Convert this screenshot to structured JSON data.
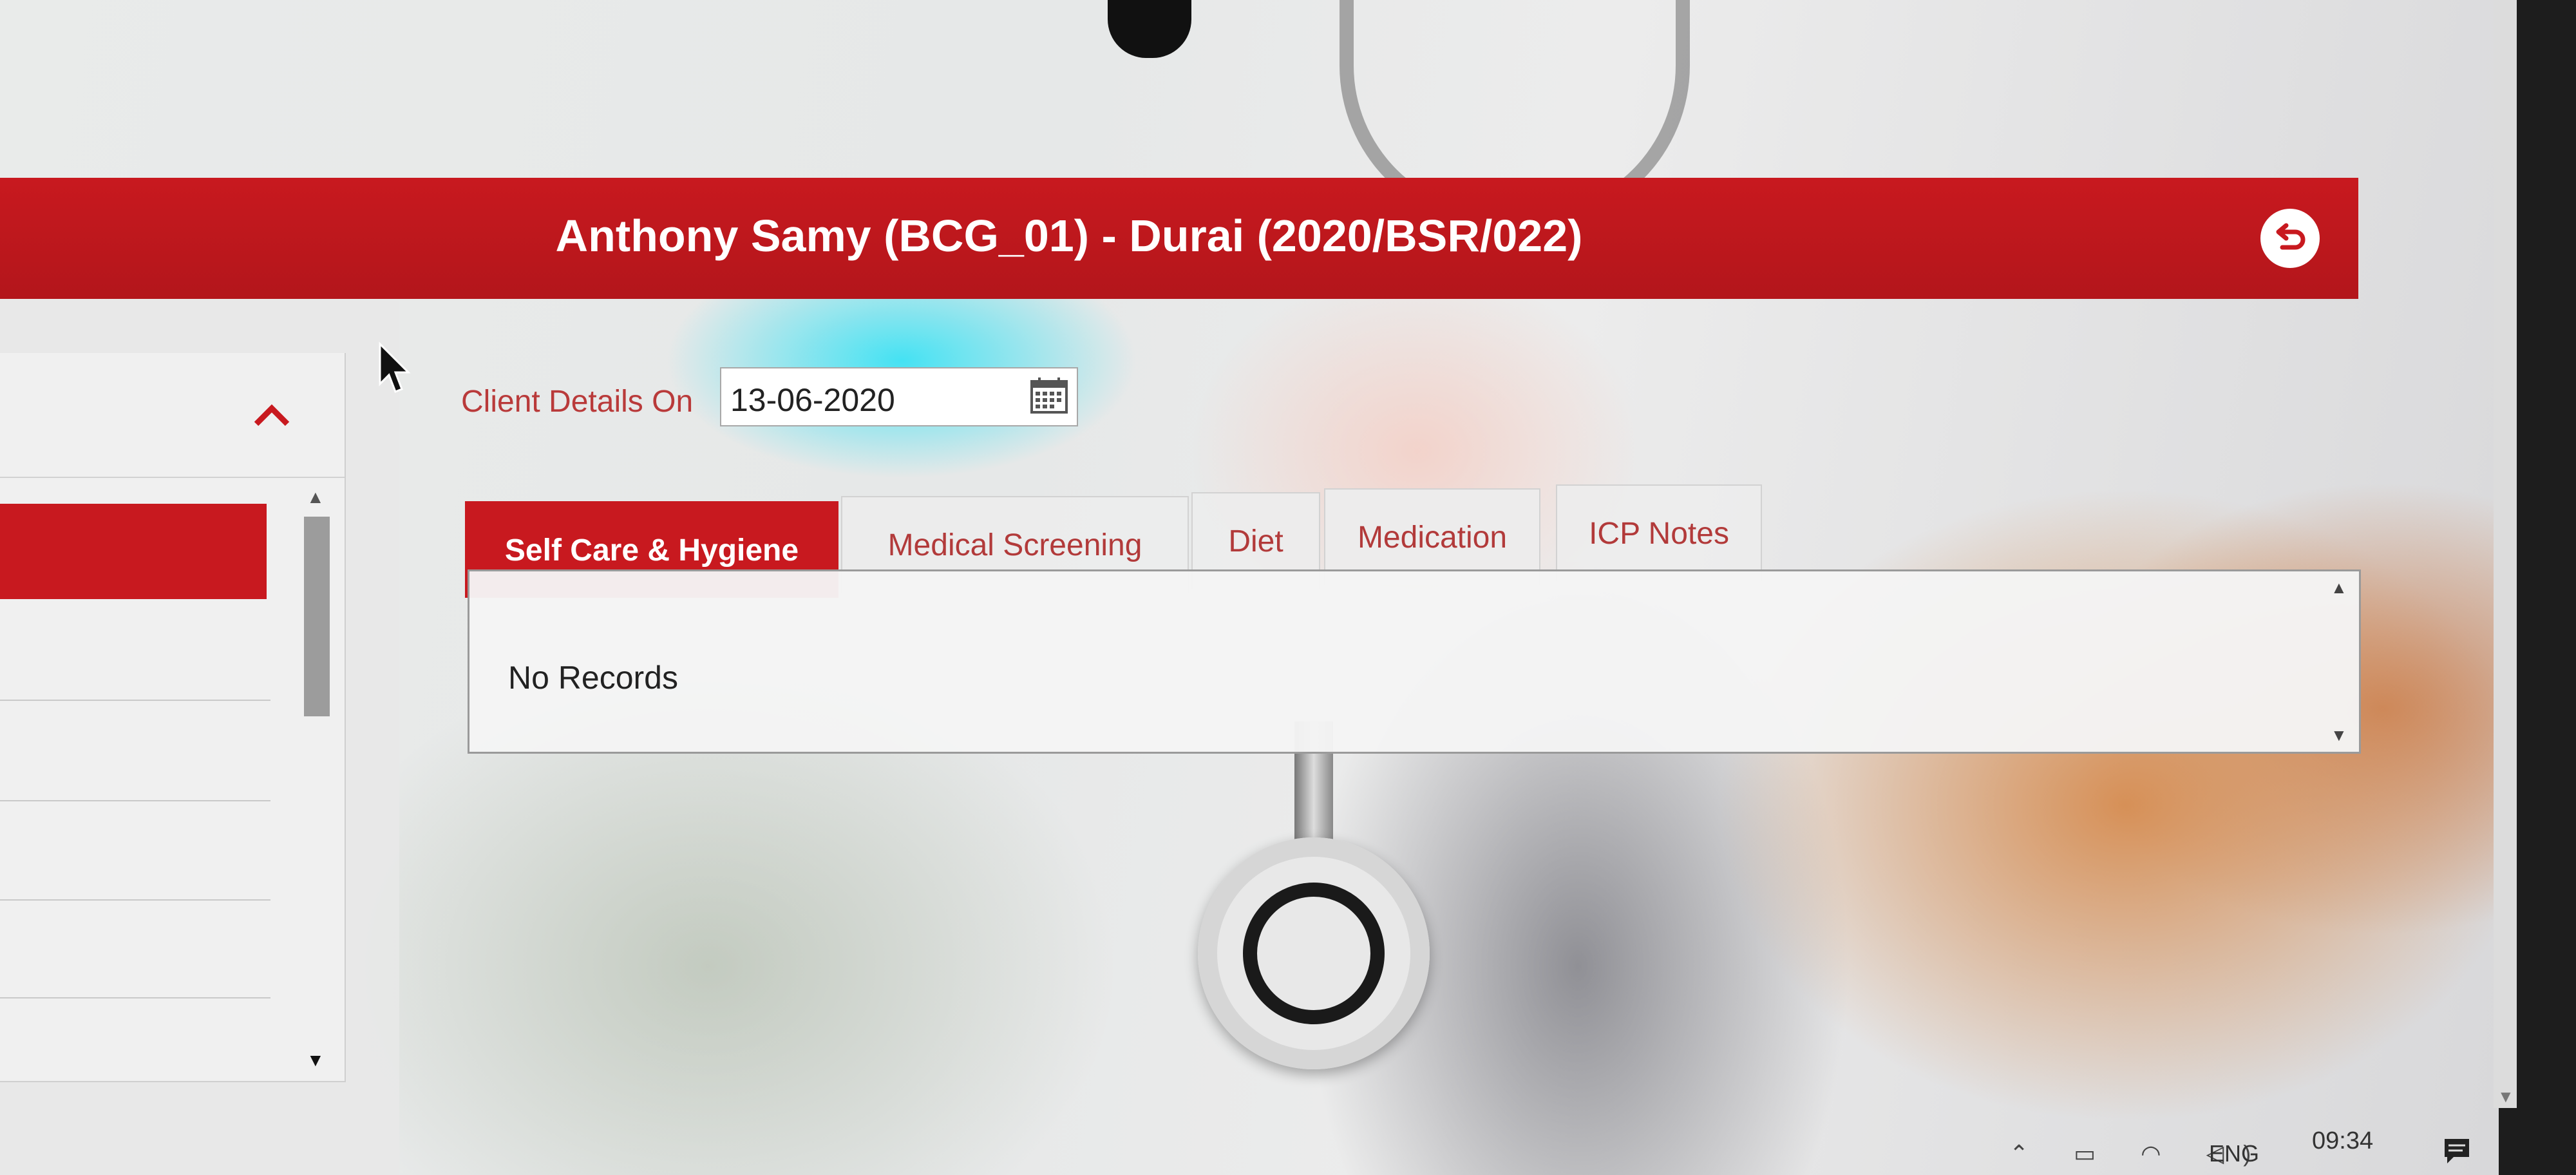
{
  "header": {
    "title": "Anthony Samy (BCG_01) - Durai (2020/BSR/022)",
    "back_icon": "back-arrow-icon"
  },
  "filter": {
    "label": "Client Details On",
    "date_value": "13-06-2020",
    "calendar_icon": "calendar-icon"
  },
  "tabs": [
    {
      "label": "Self Care & Hygiene",
      "active": true
    },
    {
      "label": "Medical Screening",
      "active": false
    },
    {
      "label": "Diet",
      "active": false
    },
    {
      "label": "Medication",
      "active": false
    },
    {
      "label": "ICP Notes",
      "active": false
    }
  ],
  "records": {
    "empty_text": "No Records"
  },
  "taskbar": {
    "language": "ENG",
    "time": "09:34"
  },
  "colors": {
    "accent": "#c8191f",
    "tab_text": "#b23a3a"
  }
}
